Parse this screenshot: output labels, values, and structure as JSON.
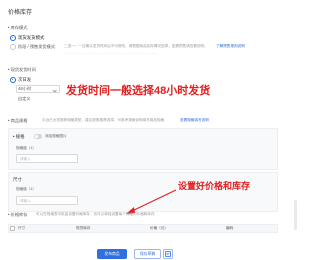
{
  "page": {
    "title": "价格库存",
    "section_inventory_mode_label": "• 库存模式",
    "inventory_modes": [
      {
        "label": "现货发货模式",
        "selected": true
      },
      {
        "label": "阶段 / 预售发货模式",
        "selected": false
      }
    ],
    "inventory_mode_hint": "二选一：一旦确认发货时间后不可修改，请根据商品实际情况选择，如需预售请查看说明。",
    "inventory_mode_link": "了解预售规则说明",
    "section_ship_time_label": "• 现货发货时间",
    "ship_time_options": [
      {
        "label": "次日发",
        "selected": true
      },
      {
        "label": "48小时",
        "selected": false
      },
      {
        "label": "自定义",
        "selected": false
      }
    ],
    "ship_time_field_placeholder": "",
    "annotation_top": "发货时间一般选择48小时发货",
    "section_spec_label": "• 商品规格",
    "spec_hint": "平台已为您推荐规格类型，建议按照推荐选择，可参考规格说明填写商品规格",
    "spec_link": "查看规格填写说明",
    "spec_groups": [
      {
        "title": "• 规格",
        "toggle_label": "添加规格图片",
        "sub_label": "规格值（1）",
        "input_placeholder": "请输入",
        "add_label": "添加"
      },
      {
        "title": "尺寸",
        "toggle_label": "",
        "sub_label": "规格值（1）",
        "input_placeholder": "请输入",
        "add_label": "添加"
      }
    ],
    "annotation_bottom": "设置好价格和库存",
    "section_price_label": "• 价格库存",
    "price_hint": "可以在规格表中批量设置价格库存，也可以单独设置每个规格的价格和库存",
    "table_headers": [
      "尺寸",
      "现货库存",
      "价格（元）",
      "编码"
    ],
    "buttons": {
      "submit": "发布商品",
      "draft": "保存草稿",
      "preview_icon": "preview-icon"
    },
    "colors": {
      "accent": "#2f6fe0",
      "annotation": "#e02020"
    }
  }
}
